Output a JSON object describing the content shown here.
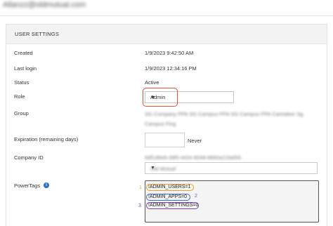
{
  "header": {
    "user_email": "Allanzz@oldmutual.com"
  },
  "panel": {
    "title": "USER SETTINGS"
  },
  "fields": {
    "created": {
      "label": "Created",
      "value": "1/9/2023 9:42:50 AM"
    },
    "last_login": {
      "label": "Last login",
      "value": "1/9/2023 12:34:16 PM"
    },
    "status": {
      "label": "Status",
      "value": "Active"
    },
    "role": {
      "label": "Role",
      "selected": "Admin"
    },
    "group": {
      "label": "Group",
      "value": "SG Company PPA SG Campus PPA SG Campus PPA Caretaker Sg Campus Fing"
    },
    "expiration": {
      "label": "Expiration (remaining days)",
      "value": "",
      "suffix": "Never"
    },
    "company_id": {
      "label": "Company ID",
      "value": "6df1d9e8-39f5-442e-8048-8860a21fa655",
      "selected": "Old Mutual"
    },
    "powertags": {
      "label": "PowerTags",
      "tags": [
        {
          "number": "1",
          "text": "!ADMIN_USERS=1"
        },
        {
          "number": "2",
          "text": "!ADMIN_APPS=0"
        },
        {
          "number": "3",
          "text": "!ADMIN_SETTINGS=0"
        }
      ]
    }
  },
  "icons": {
    "info": "info-icon",
    "dropdown": "chevron-down-icon"
  },
  "colors": {
    "role_highlight": "#e0523a",
    "tag_1": "#e5a12a",
    "tag_2": "#3d6fc4",
    "tag_3": "#7f3fa8",
    "info_icon": "#2e6fc7"
  }
}
